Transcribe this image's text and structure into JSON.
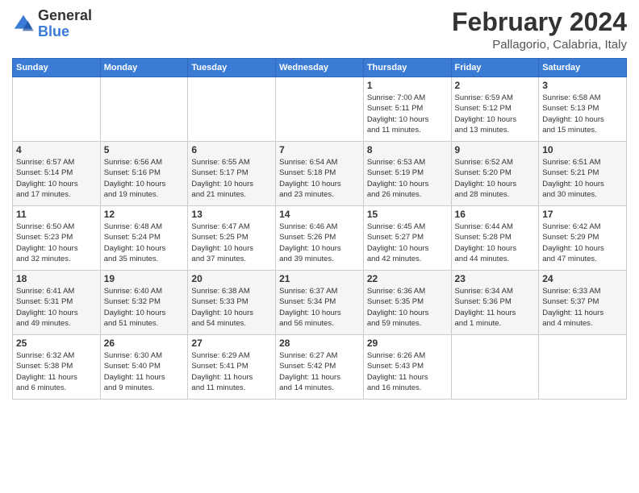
{
  "header": {
    "logo": {
      "general": "General",
      "blue": "Blue"
    },
    "title": "February 2024",
    "location": "Pallagorio, Calabria, Italy"
  },
  "calendar": {
    "days_of_week": [
      "Sunday",
      "Monday",
      "Tuesday",
      "Wednesday",
      "Thursday",
      "Friday",
      "Saturday"
    ],
    "weeks": [
      [
        {
          "day": "",
          "info": ""
        },
        {
          "day": "",
          "info": ""
        },
        {
          "day": "",
          "info": ""
        },
        {
          "day": "",
          "info": ""
        },
        {
          "day": "1",
          "info": "Sunrise: 7:00 AM\nSunset: 5:11 PM\nDaylight: 10 hours\nand 11 minutes."
        },
        {
          "day": "2",
          "info": "Sunrise: 6:59 AM\nSunset: 5:12 PM\nDaylight: 10 hours\nand 13 minutes."
        },
        {
          "day": "3",
          "info": "Sunrise: 6:58 AM\nSunset: 5:13 PM\nDaylight: 10 hours\nand 15 minutes."
        }
      ],
      [
        {
          "day": "4",
          "info": "Sunrise: 6:57 AM\nSunset: 5:14 PM\nDaylight: 10 hours\nand 17 minutes."
        },
        {
          "day": "5",
          "info": "Sunrise: 6:56 AM\nSunset: 5:16 PM\nDaylight: 10 hours\nand 19 minutes."
        },
        {
          "day": "6",
          "info": "Sunrise: 6:55 AM\nSunset: 5:17 PM\nDaylight: 10 hours\nand 21 minutes."
        },
        {
          "day": "7",
          "info": "Sunrise: 6:54 AM\nSunset: 5:18 PM\nDaylight: 10 hours\nand 23 minutes."
        },
        {
          "day": "8",
          "info": "Sunrise: 6:53 AM\nSunset: 5:19 PM\nDaylight: 10 hours\nand 26 minutes."
        },
        {
          "day": "9",
          "info": "Sunrise: 6:52 AM\nSunset: 5:20 PM\nDaylight: 10 hours\nand 28 minutes."
        },
        {
          "day": "10",
          "info": "Sunrise: 6:51 AM\nSunset: 5:21 PM\nDaylight: 10 hours\nand 30 minutes."
        }
      ],
      [
        {
          "day": "11",
          "info": "Sunrise: 6:50 AM\nSunset: 5:23 PM\nDaylight: 10 hours\nand 32 minutes."
        },
        {
          "day": "12",
          "info": "Sunrise: 6:48 AM\nSunset: 5:24 PM\nDaylight: 10 hours\nand 35 minutes."
        },
        {
          "day": "13",
          "info": "Sunrise: 6:47 AM\nSunset: 5:25 PM\nDaylight: 10 hours\nand 37 minutes."
        },
        {
          "day": "14",
          "info": "Sunrise: 6:46 AM\nSunset: 5:26 PM\nDaylight: 10 hours\nand 39 minutes."
        },
        {
          "day": "15",
          "info": "Sunrise: 6:45 AM\nSunset: 5:27 PM\nDaylight: 10 hours\nand 42 minutes."
        },
        {
          "day": "16",
          "info": "Sunrise: 6:44 AM\nSunset: 5:28 PM\nDaylight: 10 hours\nand 44 minutes."
        },
        {
          "day": "17",
          "info": "Sunrise: 6:42 AM\nSunset: 5:29 PM\nDaylight: 10 hours\nand 47 minutes."
        }
      ],
      [
        {
          "day": "18",
          "info": "Sunrise: 6:41 AM\nSunset: 5:31 PM\nDaylight: 10 hours\nand 49 minutes."
        },
        {
          "day": "19",
          "info": "Sunrise: 6:40 AM\nSunset: 5:32 PM\nDaylight: 10 hours\nand 51 minutes."
        },
        {
          "day": "20",
          "info": "Sunrise: 6:38 AM\nSunset: 5:33 PM\nDaylight: 10 hours\nand 54 minutes."
        },
        {
          "day": "21",
          "info": "Sunrise: 6:37 AM\nSunset: 5:34 PM\nDaylight: 10 hours\nand 56 minutes."
        },
        {
          "day": "22",
          "info": "Sunrise: 6:36 AM\nSunset: 5:35 PM\nDaylight: 10 hours\nand 59 minutes."
        },
        {
          "day": "23",
          "info": "Sunrise: 6:34 AM\nSunset: 5:36 PM\nDaylight: 11 hours\nand 1 minute."
        },
        {
          "day": "24",
          "info": "Sunrise: 6:33 AM\nSunset: 5:37 PM\nDaylight: 11 hours\nand 4 minutes."
        }
      ],
      [
        {
          "day": "25",
          "info": "Sunrise: 6:32 AM\nSunset: 5:38 PM\nDaylight: 11 hours\nand 6 minutes."
        },
        {
          "day": "26",
          "info": "Sunrise: 6:30 AM\nSunset: 5:40 PM\nDaylight: 11 hours\nand 9 minutes."
        },
        {
          "day": "27",
          "info": "Sunrise: 6:29 AM\nSunset: 5:41 PM\nDaylight: 11 hours\nand 11 minutes."
        },
        {
          "day": "28",
          "info": "Sunrise: 6:27 AM\nSunset: 5:42 PM\nDaylight: 11 hours\nand 14 minutes."
        },
        {
          "day": "29",
          "info": "Sunrise: 6:26 AM\nSunset: 5:43 PM\nDaylight: 11 hours\nand 16 minutes."
        },
        {
          "day": "",
          "info": ""
        },
        {
          "day": "",
          "info": ""
        }
      ]
    ]
  }
}
